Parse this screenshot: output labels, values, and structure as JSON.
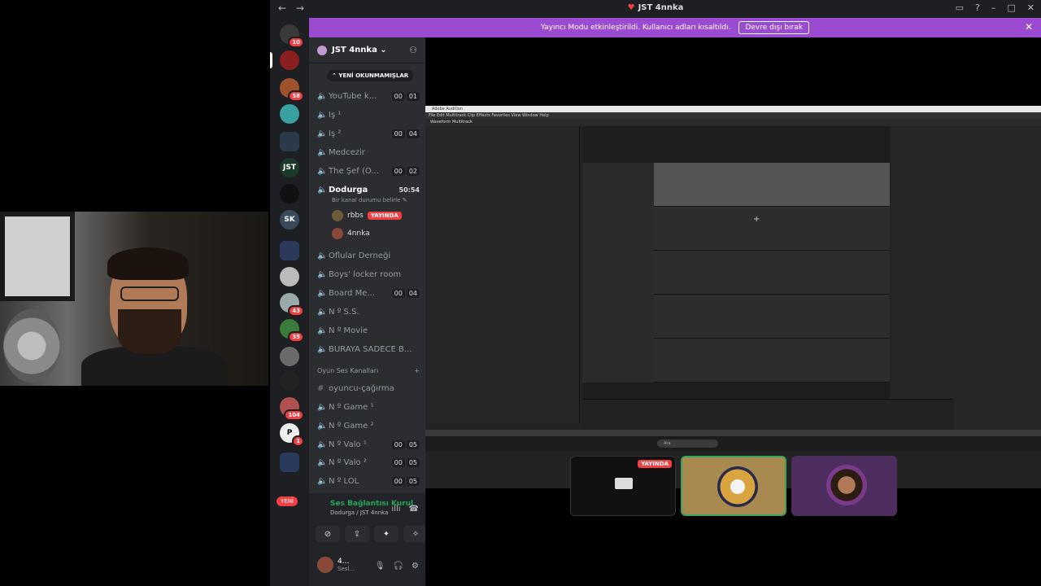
{
  "window": {
    "title": "JST 4nnka",
    "back_icon": "←",
    "forward_icon": "→"
  },
  "banner": {
    "text": "Yayıncı Modu etkinleştirildi. Kullanıcı adları kısaltıldı.",
    "button": "Devre dışı bırak"
  },
  "server_rail": {
    "badges": [
      "10",
      "58",
      "43",
      "35",
      "104",
      "1"
    ],
    "sk_label": "SK",
    "new_label": "YENİ"
  },
  "guild": {
    "name": "JST 4nnka",
    "unread_pill": "YENİ OKUNMAMIŞLAR"
  },
  "channels": [
    {
      "name": "YouTube k...",
      "m": "00",
      "n": "01"
    },
    {
      "name": "İş ¹",
      "m": "",
      "n": ""
    },
    {
      "name": "İş ²",
      "m": "00",
      "n": "04"
    },
    {
      "name": "Medcezir",
      "m": "",
      "n": ""
    },
    {
      "name": "The Şef (Ö...",
      "m": "00",
      "n": "02"
    }
  ],
  "active_channel": {
    "name": "Dodurga",
    "time": "50:54",
    "status_prompt": "Bir kanal durumu belirle",
    "members": [
      {
        "name": "rbbs",
        "live": "YAYINDA"
      },
      {
        "name": "4nnka"
      }
    ]
  },
  "channels2": [
    {
      "name": "Oflular Derneği",
      "m": "",
      "n": ""
    },
    {
      "name": "Boys' locker room",
      "m": "",
      "n": ""
    },
    {
      "name": "Board Me...",
      "m": "00",
      "n": "04"
    },
    {
      "name": "N º S.S.",
      "m": "",
      "n": ""
    },
    {
      "name": "N º Movie",
      "m": "",
      "n": ""
    },
    {
      "name": "BURAYA SADECE B...",
      "m": "",
      "n": ""
    }
  ],
  "category": {
    "name": "Oyun Ses Kanalları",
    "add": "+"
  },
  "channels3": [
    {
      "name": "oyuncu-çağırma",
      "m": "",
      "n": ""
    },
    {
      "name": "N º Game ¹",
      "m": "",
      "n": ""
    },
    {
      "name": "N º Game ²",
      "m": "",
      "n": ""
    },
    {
      "name": "N º Valo ¹",
      "m": "00",
      "n": "05"
    },
    {
      "name": "N º Valo ²",
      "m": "00",
      "n": "05"
    },
    {
      "name": "N º LOL",
      "m": "00",
      "n": "05"
    }
  ],
  "voice_panel": {
    "status": "Ses Bağlantısı Kurul",
    "location": "Dodurga / JST 4nnka",
    "user_name": "4...",
    "user_status": "Sesl..."
  },
  "stream": {
    "tile1_live": "YAYINDA"
  },
  "audition": {
    "app_title": "Adobe Audition",
    "menu": "File  Edit  Multitrack  Clip  Effects  Favorites  View  Window  Help",
    "tools": "Waveform   Multitrack",
    "search_placeholder": "Ara"
  },
  "colors": {
    "banner": "#9b4bd1",
    "live": "#f23f43",
    "voice_green": "#23a55a"
  }
}
